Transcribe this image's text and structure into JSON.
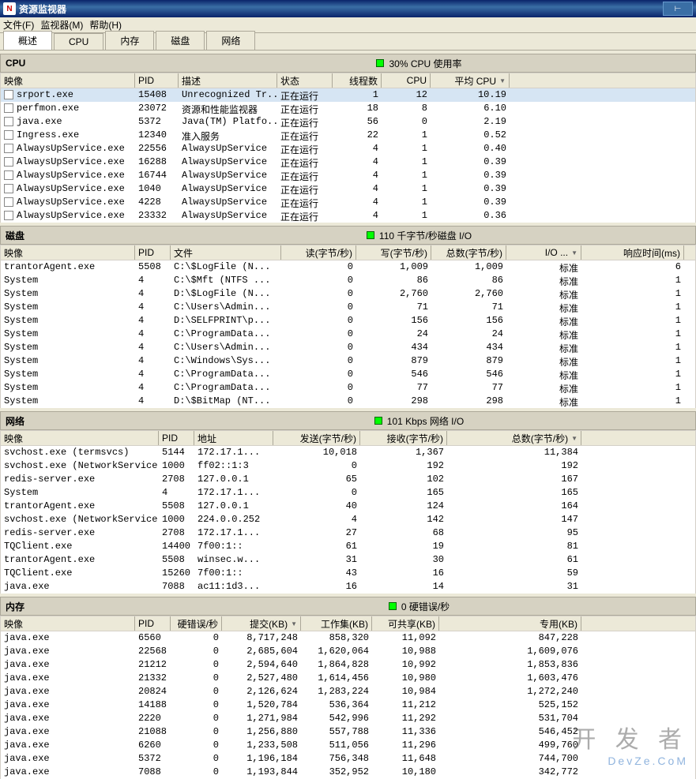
{
  "window": {
    "title": "资源监视器"
  },
  "menu": {
    "file": "文件(F)",
    "monitor": "监视器(M)",
    "help": "帮助(H)"
  },
  "tabs": {
    "overview": "概述",
    "cpu": "CPU",
    "memory": "内存",
    "disk": "磁盘",
    "network": "网络"
  },
  "cpu": {
    "title": "CPU",
    "status": "30% CPU 使用率",
    "headers": {
      "image": "映像",
      "pid": "PID",
      "desc": "描述",
      "state": "状态",
      "threads": "线程数",
      "cpu": "CPU",
      "avg": "平均 CPU"
    },
    "rows": [
      {
        "image": "srport.exe",
        "pid": "15408",
        "desc": "Unrecognized Tr...",
        "state": "正在运行",
        "threads": "1",
        "cpu": "12",
        "avg": "10.19",
        "sel": true
      },
      {
        "image": "perfmon.exe",
        "pid": "23072",
        "desc": "资源和性能监视器",
        "state": "正在运行",
        "threads": "18",
        "cpu": "8",
        "avg": "6.10"
      },
      {
        "image": "java.exe",
        "pid": "5372",
        "desc": "Java(TM) Platfo...",
        "state": "正在运行",
        "threads": "56",
        "cpu": "0",
        "avg": "2.19"
      },
      {
        "image": "Ingress.exe",
        "pid": "12340",
        "desc": "准入服务",
        "state": "正在运行",
        "threads": "22",
        "cpu": "1",
        "avg": "0.52"
      },
      {
        "image": "AlwaysUpService.exe",
        "pid": "22556",
        "desc": "AlwaysUpService",
        "state": "正在运行",
        "threads": "4",
        "cpu": "1",
        "avg": "0.40"
      },
      {
        "image": "AlwaysUpService.exe",
        "pid": "16288",
        "desc": "AlwaysUpService",
        "state": "正在运行",
        "threads": "4",
        "cpu": "1",
        "avg": "0.39"
      },
      {
        "image": "AlwaysUpService.exe",
        "pid": "16744",
        "desc": "AlwaysUpService",
        "state": "正在运行",
        "threads": "4",
        "cpu": "1",
        "avg": "0.39"
      },
      {
        "image": "AlwaysUpService.exe",
        "pid": "1040",
        "desc": "AlwaysUpService",
        "state": "正在运行",
        "threads": "4",
        "cpu": "1",
        "avg": "0.39"
      },
      {
        "image": "AlwaysUpService.exe",
        "pid": "4228",
        "desc": "AlwaysUpService",
        "state": "正在运行",
        "threads": "4",
        "cpu": "1",
        "avg": "0.39"
      },
      {
        "image": "AlwaysUpService.exe",
        "pid": "23332",
        "desc": "AlwaysUpService",
        "state": "正在运行",
        "threads": "4",
        "cpu": "1",
        "avg": "0.36"
      }
    ]
  },
  "disk": {
    "title": "磁盘",
    "status": "110 千字节/秒磁盘 I/O",
    "headers": {
      "image": "映像",
      "pid": "PID",
      "file": "文件",
      "read": "读(字节/秒)",
      "write": "写(字节/秒)",
      "total": "总数(字节/秒)",
      "io": "I/O ...",
      "resp": "响应时间(ms)"
    },
    "rows": [
      {
        "image": "trantorAgent.exe",
        "pid": "5508",
        "file": "C:\\$LogFile (N...",
        "read": "0",
        "write": "1,009",
        "total": "1,009",
        "io": "标准",
        "resp": "6"
      },
      {
        "image": "System",
        "pid": "4",
        "file": "C:\\$Mft (NTFS ...",
        "read": "0",
        "write": "86",
        "total": "86",
        "io": "标准",
        "resp": "1"
      },
      {
        "image": "System",
        "pid": "4",
        "file": "D:\\$LogFile (N...",
        "read": "0",
        "write": "2,760",
        "total": "2,760",
        "io": "标准",
        "resp": "1"
      },
      {
        "image": "System",
        "pid": "4",
        "file": "C:\\Users\\Admin...",
        "read": "0",
        "write": "71",
        "total": "71",
        "io": "标准",
        "resp": "1"
      },
      {
        "image": "System",
        "pid": "4",
        "file": "D:\\SELFPRINT\\p...",
        "read": "0",
        "write": "156",
        "total": "156",
        "io": "标准",
        "resp": "1"
      },
      {
        "image": "System",
        "pid": "4",
        "file": "C:\\ProgramData...",
        "read": "0",
        "write": "24",
        "total": "24",
        "io": "标准",
        "resp": "1"
      },
      {
        "image": "System",
        "pid": "4",
        "file": "C:\\Users\\Admin...",
        "read": "0",
        "write": "434",
        "total": "434",
        "io": "标准",
        "resp": "1"
      },
      {
        "image": "System",
        "pid": "4",
        "file": "C:\\Windows\\Sys...",
        "read": "0",
        "write": "879",
        "total": "879",
        "io": "标准",
        "resp": "1"
      },
      {
        "image": "System",
        "pid": "4",
        "file": "C:\\ProgramData...",
        "read": "0",
        "write": "546",
        "total": "546",
        "io": "标准",
        "resp": "1"
      },
      {
        "image": "System",
        "pid": "4",
        "file": "C:\\ProgramData...",
        "read": "0",
        "write": "77",
        "total": "77",
        "io": "标准",
        "resp": "1"
      },
      {
        "image": "System",
        "pid": "4",
        "file": "D:\\$BitMap (NT...",
        "read": "0",
        "write": "298",
        "total": "298",
        "io": "标准",
        "resp": "1"
      }
    ]
  },
  "network": {
    "title": "网络",
    "status": "101 Kbps 网络 I/O",
    "headers": {
      "image": "映像",
      "pid": "PID",
      "addr": "地址",
      "send": "发送(字节/秒)",
      "recv": "接收(字节/秒)",
      "total": "总数(字节/秒)"
    },
    "rows": [
      {
        "image": "svchost.exe (termsvcs)",
        "pid": "5144",
        "addr": "172.17.1...",
        "send": "10,018",
        "recv": "1,367",
        "total": "11,384"
      },
      {
        "image": "svchost.exe (NetworkService)",
        "pid": "1000",
        "addr": "ff02::1:3",
        "send": "0",
        "recv": "192",
        "total": "192"
      },
      {
        "image": "redis-server.exe",
        "pid": "2708",
        "addr": "127.0.0.1",
        "send": "65",
        "recv": "102",
        "total": "167"
      },
      {
        "image": "System",
        "pid": "4",
        "addr": "172.17.1...",
        "send": "0",
        "recv": "165",
        "total": "165"
      },
      {
        "image": "trantorAgent.exe",
        "pid": "5508",
        "addr": "127.0.0.1",
        "send": "40",
        "recv": "124",
        "total": "164"
      },
      {
        "image": "svchost.exe (NetworkService)",
        "pid": "1000",
        "addr": "224.0.0.252",
        "send": "4",
        "recv": "142",
        "total": "147"
      },
      {
        "image": "redis-server.exe",
        "pid": "2708",
        "addr": "172.17.1...",
        "send": "27",
        "recv": "68",
        "total": "95"
      },
      {
        "image": "TQClient.exe",
        "pid": "14400",
        "addr": "7f00:1::",
        "send": "61",
        "recv": "19",
        "total": "81"
      },
      {
        "image": "trantorAgent.exe",
        "pid": "5508",
        "addr": "winsec.w...",
        "send": "31",
        "recv": "30",
        "total": "61"
      },
      {
        "image": "TQClient.exe",
        "pid": "15260",
        "addr": "7f00:1::",
        "send": "43",
        "recv": "16",
        "total": "59"
      },
      {
        "image": "java.exe",
        "pid": "7088",
        "addr": "ac11:1d3...",
        "send": "16",
        "recv": "14",
        "total": "31"
      }
    ]
  },
  "memory": {
    "title": "内存",
    "status": "0 硬错误/秒",
    "headers": {
      "image": "映像",
      "pid": "PID",
      "hard": "硬错误/秒",
      "commit": "提交(KB)",
      "working": "工作集(KB)",
      "shared": "可共享(KB)",
      "private": "专用(KB)"
    },
    "rows": [
      {
        "image": "java.exe",
        "pid": "6560",
        "hard": "0",
        "commit": "8,717,248",
        "working": "858,320",
        "shared": "11,092",
        "private": "847,228"
      },
      {
        "image": "java.exe",
        "pid": "22568",
        "hard": "0",
        "commit": "2,685,604",
        "working": "1,620,064",
        "shared": "10,988",
        "private": "1,609,076"
      },
      {
        "image": "java.exe",
        "pid": "21212",
        "hard": "0",
        "commit": "2,594,640",
        "working": "1,864,828",
        "shared": "10,992",
        "private": "1,853,836"
      },
      {
        "image": "java.exe",
        "pid": "21332",
        "hard": "0",
        "commit": "2,527,480",
        "working": "1,614,456",
        "shared": "10,980",
        "private": "1,603,476"
      },
      {
        "image": "java.exe",
        "pid": "20824",
        "hard": "0",
        "commit": "2,126,624",
        "working": "1,283,224",
        "shared": "10,984",
        "private": "1,272,240"
      },
      {
        "image": "java.exe",
        "pid": "14188",
        "hard": "0",
        "commit": "1,520,784",
        "working": "536,364",
        "shared": "11,212",
        "private": "525,152"
      },
      {
        "image": "java.exe",
        "pid": "2220",
        "hard": "0",
        "commit": "1,271,984",
        "working": "542,996",
        "shared": "11,292",
        "private": "531,704"
      },
      {
        "image": "java.exe",
        "pid": "21088",
        "hard": "0",
        "commit": "1,256,880",
        "working": "557,788",
        "shared": "11,336",
        "private": "546,452"
      },
      {
        "image": "java.exe",
        "pid": "6260",
        "hard": "0",
        "commit": "1,233,508",
        "working": "511,056",
        "shared": "11,296",
        "private": "499,760"
      },
      {
        "image": "java.exe",
        "pid": "5372",
        "hard": "0",
        "commit": "1,196,184",
        "working": "756,348",
        "shared": "11,648",
        "private": "744,700"
      },
      {
        "image": "java.exe",
        "pid": "7088",
        "hard": "0",
        "commit": "1,193,844",
        "working": "352,952",
        "shared": "10,180",
        "private": "342,772"
      }
    ]
  },
  "watermark": {
    "l1": "开 发 者",
    "l2": "DevZe.CoM"
  }
}
